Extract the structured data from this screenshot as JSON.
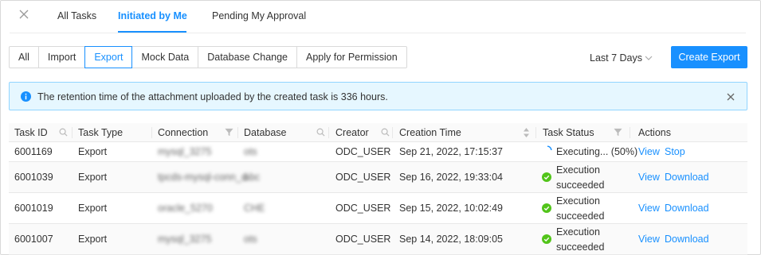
{
  "tabs": [
    {
      "label": "All Tasks",
      "active": false
    },
    {
      "label": "Initiated by Me",
      "active": true
    },
    {
      "label": "Pending My Approval",
      "active": false
    }
  ],
  "filters": [
    {
      "label": "All",
      "active": false
    },
    {
      "label": "Import",
      "active": false
    },
    {
      "label": "Export",
      "active": true
    },
    {
      "label": "Mock Data",
      "active": false
    },
    {
      "label": "Database Change",
      "active": false
    },
    {
      "label": "Apply for Permission",
      "active": false
    }
  ],
  "time_range": "Last 7 Days",
  "create_button": "Create Export",
  "alert": {
    "message": "The retention time of the attachment uploaded by the created task is 336 hours."
  },
  "columns": [
    "Task ID",
    "Task Type",
    "Connection",
    "Database",
    "Creator",
    "Creation Time",
    "Task Status",
    "Actions"
  ],
  "rows": [
    {
      "id": "6001169",
      "type": "Export",
      "connection": "mysql_3275",
      "database": "ots",
      "creator": "ODC_USER",
      "time": "Sep 21, 2022, 17:15:37",
      "status": "Executing... (50%)",
      "actions": [
        "View",
        "Stop"
      ]
    },
    {
      "id": "6001039",
      "type": "Export",
      "connection": "tpcds-mysql-conn_d",
      "database": "abc",
      "creator": "ODC_USER",
      "time": "Sep 16, 2022, 19:33:04",
      "status": "Execution succeeded",
      "actions": [
        "View",
        "Download"
      ]
    },
    {
      "id": "6001019",
      "type": "Export",
      "connection": "oracle_5270",
      "database": "CHE",
      "creator": "ODC_USER",
      "time": "Sep 15, 2022, 10:02:49",
      "status": "Execution succeeded",
      "actions": [
        "View",
        "Download"
      ]
    },
    {
      "id": "6001007",
      "type": "Export",
      "connection": "mysql_3275",
      "database": "ots",
      "creator": "ODC_USER",
      "time": "Sep 14, 2022, 18:09:05",
      "status": "Execution succeeded",
      "actions": [
        "View",
        "Download"
      ]
    }
  ],
  "colors": {
    "primary": "#1890ff",
    "success": "#52c41a",
    "alert_bg": "#e6f7ff"
  }
}
